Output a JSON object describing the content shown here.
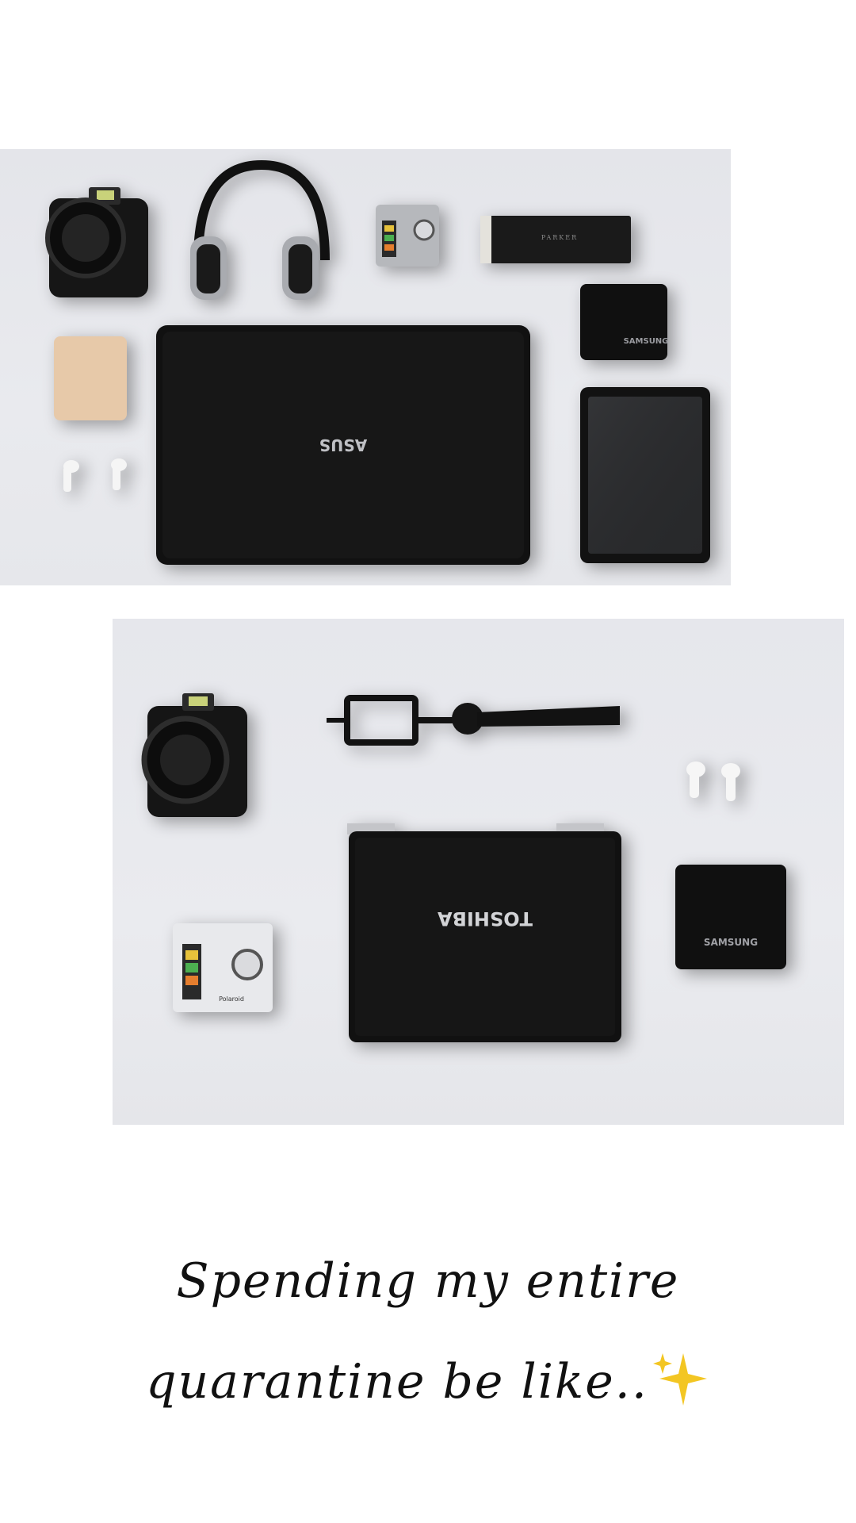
{
  "post": {
    "caption_line1": "Spending my entire",
    "caption_line2": "quarantine be like..",
    "caption_emoji": "sparkles-emoji"
  },
  "photo1": {
    "items": [
      "action-camera",
      "headphones",
      "polaroid-camera",
      "pen-box",
      "power-bank",
      "laptop",
      "earbuds",
      "external-drive",
      "tablet"
    ],
    "laptop_brand": "ASUS",
    "drive_brand": "SAMSUNG",
    "pen_brand": "PARKER"
  },
  "photo2": {
    "items": [
      "action-camera",
      "tripod",
      "earbuds",
      "laptop",
      "polaroid-camera",
      "external-drive"
    ],
    "laptop_brand": "TOSHIBA",
    "drive_brand": "SAMSUNG",
    "camera_brand": "Polaroid"
  },
  "colors": {
    "surface": "#e6e7eb",
    "device": "#141414",
    "sparkle": "#f3c623"
  }
}
